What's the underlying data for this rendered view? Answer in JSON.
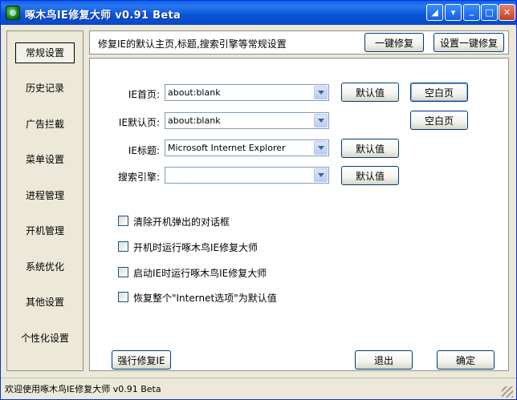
{
  "window": {
    "title": "啄木鸟IE修复大师 v0.91 Beta",
    "controls": {
      "help": "◢",
      "menu": "▾",
      "minimize": "_",
      "maximize": "□",
      "close": "✕"
    }
  },
  "sidebar": {
    "items": [
      {
        "label": "常规设置",
        "active": true
      },
      {
        "label": "历史记录"
      },
      {
        "label": "广告拦截"
      },
      {
        "label": "菜单设置"
      },
      {
        "label": "进程管理"
      },
      {
        "label": "开机管理"
      },
      {
        "label": "系统优化"
      },
      {
        "label": "其他设置"
      },
      {
        "label": "个性化设置"
      }
    ]
  },
  "topbar": {
    "description": "修复IE的默认主页,标题,搜索引擎等常规设置",
    "one_click_repair": "一键修复",
    "set_one_click_repair": "设置一键修复"
  },
  "form": {
    "homepage": {
      "label": "IE首页:",
      "value": "about:blank",
      "default_btn": "默认值",
      "blank_btn": "空白页"
    },
    "default_page": {
      "label": "IE默认页:",
      "value": "about:blank",
      "blank_btn": "空白页"
    },
    "title": {
      "label": "IE标题:",
      "value": "Microsoft Internet Explorer",
      "default_btn": "默认值"
    },
    "search": {
      "label": "搜索引擎:",
      "value": "",
      "default_btn": "默认值"
    }
  },
  "checkboxes": [
    {
      "label": "清除开机弹出的对话框",
      "checked": false
    },
    {
      "label": "开机时运行啄木鸟IE修复大师",
      "checked": false
    },
    {
      "label": "启动IE时运行啄木鸟IE修复大师",
      "checked": false
    },
    {
      "label": "恢复整个\"Internet选项\"为默认值",
      "checked": false
    }
  ],
  "actions": {
    "force_repair": "强行修复IE",
    "exit": "退出",
    "ok": "确定"
  },
  "status": {
    "text": "欢迎使用啄木鸟IE修复大师 v0.91 Beta"
  },
  "colors": {
    "titlebar": "#0A5FE8",
    "window_bg": "#ECE9D8",
    "button_border": "#003C74"
  }
}
